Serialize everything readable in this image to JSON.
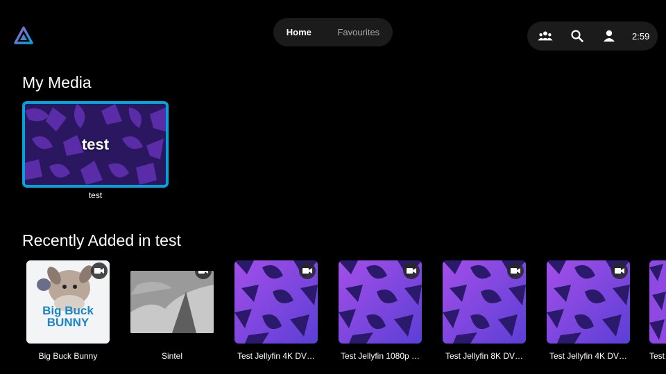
{
  "nav": {
    "tabs": [
      {
        "label": "Home"
      },
      {
        "label": "Favourites"
      }
    ]
  },
  "header": {
    "time": "2:59",
    "icons": [
      "users-icon",
      "search-icon",
      "user-icon"
    ]
  },
  "sections": {
    "my_media": {
      "title": "My Media",
      "libraries": [
        {
          "card_text": "test",
          "caption": "test"
        }
      ]
    },
    "recently_added": {
      "title": "Recently Added in test",
      "items": [
        {
          "caption": "Big Buck Bunny",
          "poster_text": "Big Buck BUNNY"
        },
        {
          "caption": "Sintel"
        },
        {
          "caption": "Test Jellyfin 4K DV…"
        },
        {
          "caption": "Test Jellyfin 1080p …"
        },
        {
          "caption": "Test Jellyfin 8K DV…"
        },
        {
          "caption": "Test Jellyfin 4K DV…"
        },
        {
          "caption": "Test"
        }
      ]
    }
  },
  "colors": {
    "accent": "#00a4dc",
    "pattern_dark": "#3a1f8a",
    "pattern_bright": "#9b4fe0",
    "background": "#000000"
  }
}
